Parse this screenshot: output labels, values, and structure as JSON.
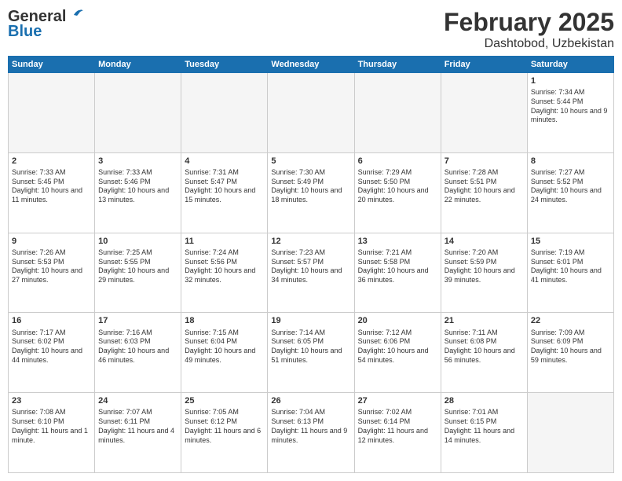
{
  "header": {
    "logo_general": "General",
    "logo_blue": "Blue",
    "month_title": "February 2025",
    "location": "Dashtobod, Uzbekistan"
  },
  "days_of_week": [
    "Sunday",
    "Monday",
    "Tuesday",
    "Wednesday",
    "Thursday",
    "Friday",
    "Saturday"
  ],
  "weeks": [
    [
      {
        "day": "",
        "empty": true
      },
      {
        "day": "",
        "empty": true
      },
      {
        "day": "",
        "empty": true
      },
      {
        "day": "",
        "empty": true
      },
      {
        "day": "",
        "empty": true
      },
      {
        "day": "",
        "empty": true
      },
      {
        "day": "1",
        "sunrise": "7:34 AM",
        "sunset": "5:44 PM",
        "daylight": "10 hours and 9 minutes."
      }
    ],
    [
      {
        "day": "2",
        "sunrise": "7:33 AM",
        "sunset": "5:45 PM",
        "daylight": "10 hours and 11 minutes."
      },
      {
        "day": "3",
        "sunrise": "7:33 AM",
        "sunset": "5:46 PM",
        "daylight": "10 hours and 13 minutes."
      },
      {
        "day": "4",
        "sunrise": "7:31 AM",
        "sunset": "5:47 PM",
        "daylight": "10 hours and 15 minutes."
      },
      {
        "day": "5",
        "sunrise": "7:30 AM",
        "sunset": "5:49 PM",
        "daylight": "10 hours and 18 minutes."
      },
      {
        "day": "6",
        "sunrise": "7:29 AM",
        "sunset": "5:50 PM",
        "daylight": "10 hours and 20 minutes."
      },
      {
        "day": "7",
        "sunrise": "7:28 AM",
        "sunset": "5:51 PM",
        "daylight": "10 hours and 22 minutes."
      },
      {
        "day": "8",
        "sunrise": "7:27 AM",
        "sunset": "5:52 PM",
        "daylight": "10 hours and 24 minutes."
      }
    ],
    [
      {
        "day": "9",
        "sunrise": "7:26 AM",
        "sunset": "5:53 PM",
        "daylight": "10 hours and 27 minutes."
      },
      {
        "day": "10",
        "sunrise": "7:25 AM",
        "sunset": "5:55 PM",
        "daylight": "10 hours and 29 minutes."
      },
      {
        "day": "11",
        "sunrise": "7:24 AM",
        "sunset": "5:56 PM",
        "daylight": "10 hours and 32 minutes."
      },
      {
        "day": "12",
        "sunrise": "7:23 AM",
        "sunset": "5:57 PM",
        "daylight": "10 hours and 34 minutes."
      },
      {
        "day": "13",
        "sunrise": "7:21 AM",
        "sunset": "5:58 PM",
        "daylight": "10 hours and 36 minutes."
      },
      {
        "day": "14",
        "sunrise": "7:20 AM",
        "sunset": "5:59 PM",
        "daylight": "10 hours and 39 minutes."
      },
      {
        "day": "15",
        "sunrise": "7:19 AM",
        "sunset": "6:01 PM",
        "daylight": "10 hours and 41 minutes."
      }
    ],
    [
      {
        "day": "16",
        "sunrise": "7:17 AM",
        "sunset": "6:02 PM",
        "daylight": "10 hours and 44 minutes."
      },
      {
        "day": "17",
        "sunrise": "7:16 AM",
        "sunset": "6:03 PM",
        "daylight": "10 hours and 46 minutes."
      },
      {
        "day": "18",
        "sunrise": "7:15 AM",
        "sunset": "6:04 PM",
        "daylight": "10 hours and 49 minutes."
      },
      {
        "day": "19",
        "sunrise": "7:14 AM",
        "sunset": "6:05 PM",
        "daylight": "10 hours and 51 minutes."
      },
      {
        "day": "20",
        "sunrise": "7:12 AM",
        "sunset": "6:06 PM",
        "daylight": "10 hours and 54 minutes."
      },
      {
        "day": "21",
        "sunrise": "7:11 AM",
        "sunset": "6:08 PM",
        "daylight": "10 hours and 56 minutes."
      },
      {
        "day": "22",
        "sunrise": "7:09 AM",
        "sunset": "6:09 PM",
        "daylight": "10 hours and 59 minutes."
      }
    ],
    [
      {
        "day": "23",
        "sunrise": "7:08 AM",
        "sunset": "6:10 PM",
        "daylight": "11 hours and 1 minute."
      },
      {
        "day": "24",
        "sunrise": "7:07 AM",
        "sunset": "6:11 PM",
        "daylight": "11 hours and 4 minutes."
      },
      {
        "day": "25",
        "sunrise": "7:05 AM",
        "sunset": "6:12 PM",
        "daylight": "11 hours and 6 minutes."
      },
      {
        "day": "26",
        "sunrise": "7:04 AM",
        "sunset": "6:13 PM",
        "daylight": "11 hours and 9 minutes."
      },
      {
        "day": "27",
        "sunrise": "7:02 AM",
        "sunset": "6:14 PM",
        "daylight": "11 hours and 12 minutes."
      },
      {
        "day": "28",
        "sunrise": "7:01 AM",
        "sunset": "6:15 PM",
        "daylight": "11 hours and 14 minutes."
      },
      {
        "day": "",
        "empty": true
      }
    ]
  ]
}
